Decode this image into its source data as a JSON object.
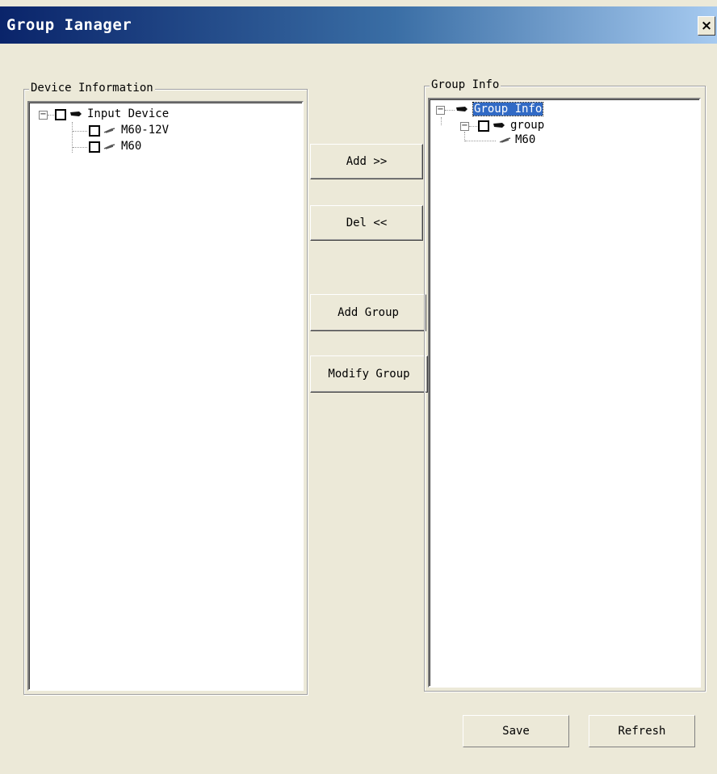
{
  "window": {
    "title": "Group Ianager",
    "close_glyph": "×"
  },
  "device_panel": {
    "legend": "Device Information",
    "root": {
      "label": "Input Device",
      "expander": "−",
      "icon": "folder-device-icon"
    },
    "items": [
      {
        "label": "M60-12V",
        "icon": "device-plug-icon"
      },
      {
        "label": "M60",
        "icon": "device-plug-icon"
      }
    ]
  },
  "group_panel": {
    "legend": "Group Info",
    "root": {
      "label": "Group Info",
      "expander": "−",
      "selected": true
    },
    "group": {
      "label": "group",
      "expander": "−"
    },
    "items": [
      {
        "label": "M60",
        "icon": "device-plug-icon"
      }
    ]
  },
  "actions": {
    "add": "Add >>",
    "del": "Del <<",
    "add_group": "Add Group",
    "modify_group": "Modify Group"
  },
  "footer": {
    "save": "Save",
    "refresh": "Refresh"
  },
  "colors": {
    "face": "#ECE9D8",
    "title_start": "#0A246A",
    "title_end": "#A6CAF0",
    "selection": "#316AC5"
  }
}
